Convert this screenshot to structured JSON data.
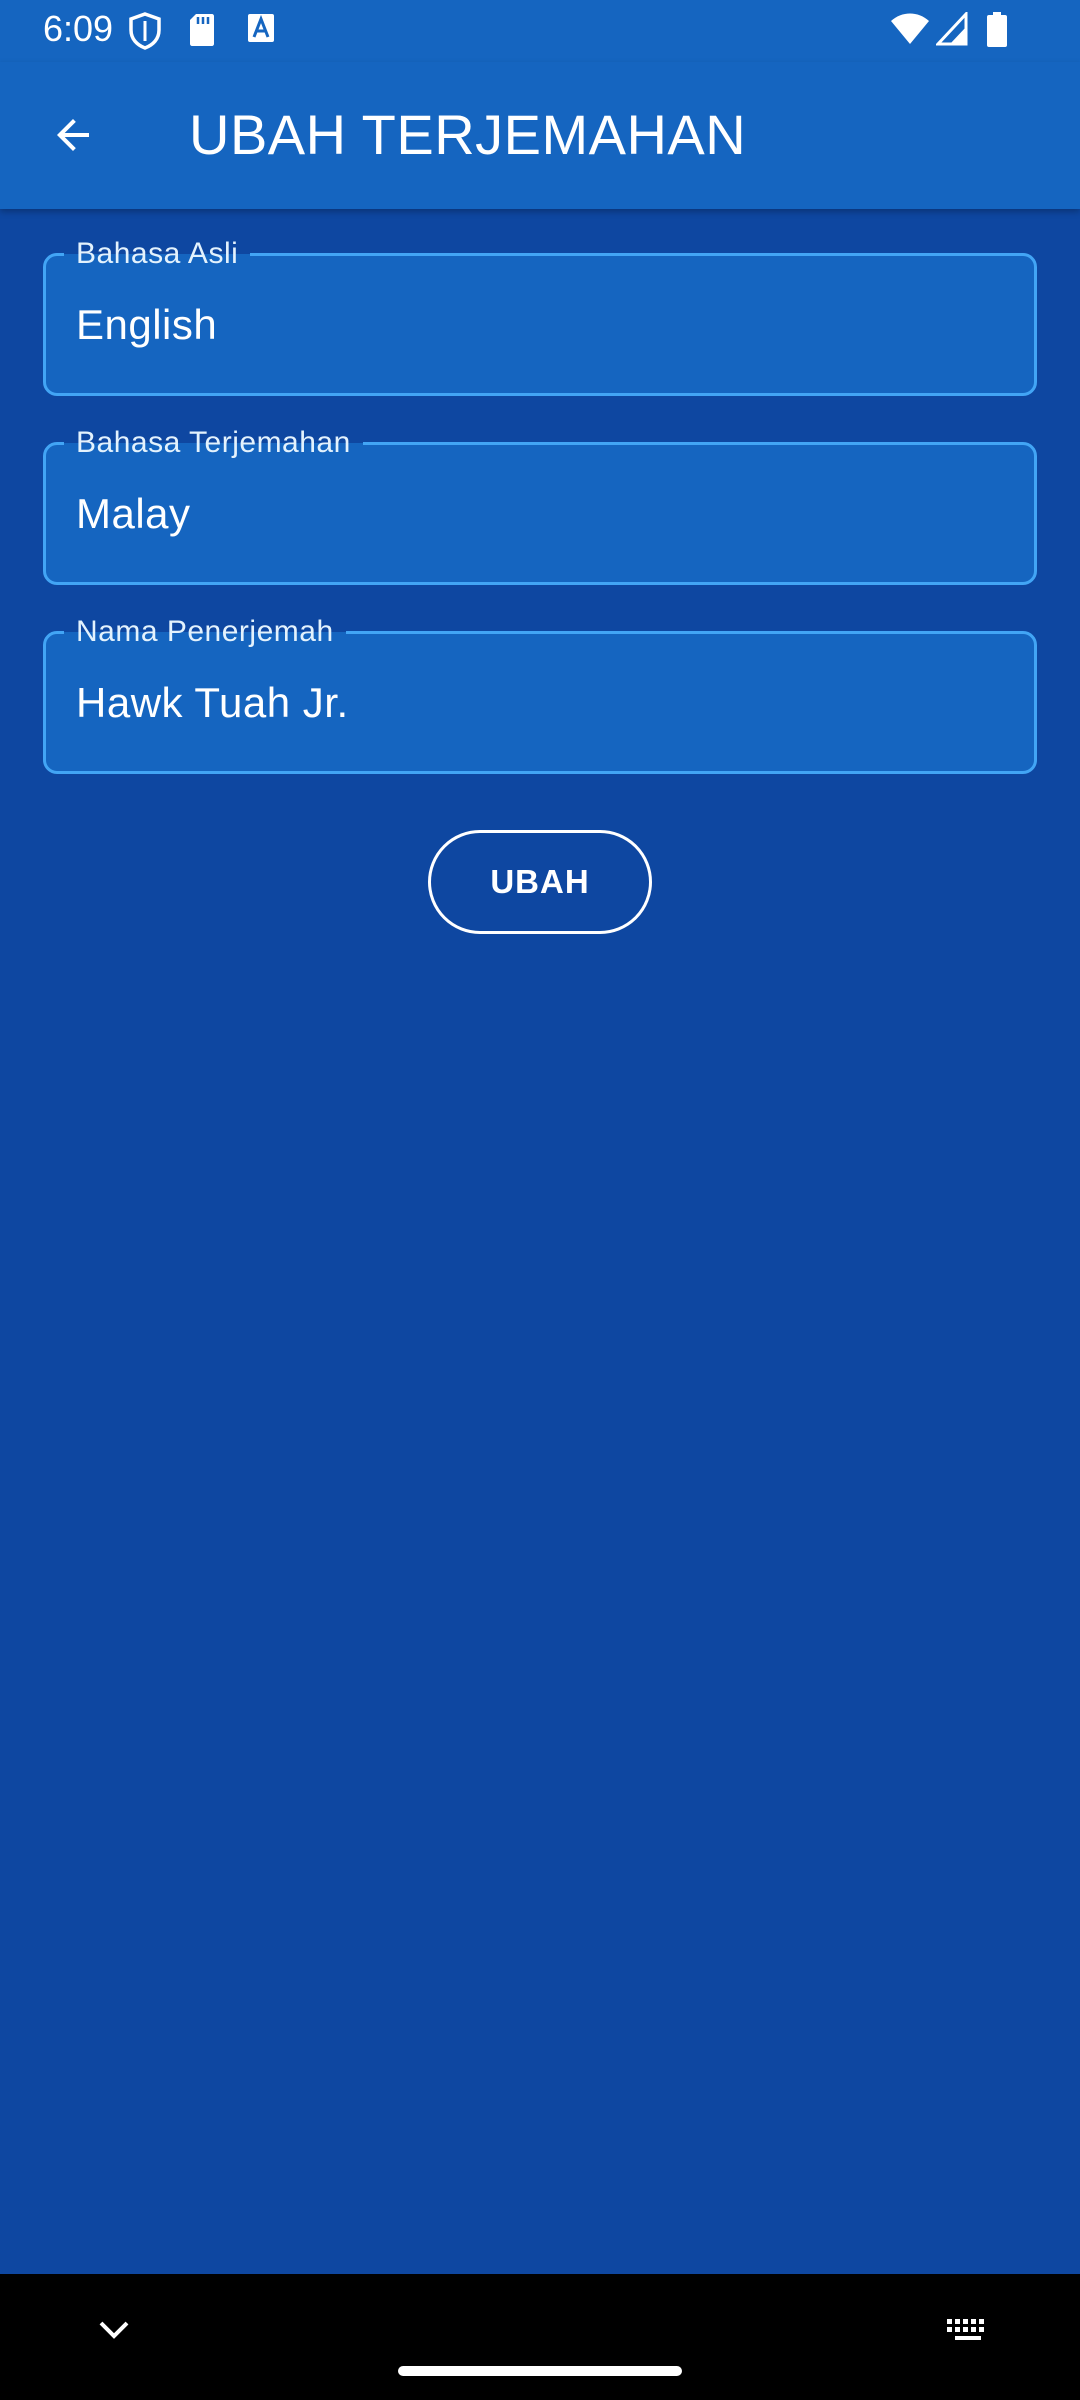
{
  "status_bar": {
    "time": "6:09",
    "left_icons": [
      "shield-icon",
      "sd-card-icon",
      "font-icon"
    ],
    "right_icons": [
      "wifi-icon",
      "signal-icon",
      "battery-icon"
    ]
  },
  "app_bar": {
    "title": "UBAH TERJEMAHAN",
    "back_icon": "arrow-back-icon"
  },
  "form": {
    "fields": [
      {
        "label": "Bahasa Asli",
        "value": "English"
      },
      {
        "label": "Bahasa Terjemahan",
        "value": "Malay"
      },
      {
        "label": "Nama Penerjemah",
        "value": "Hawk Tuah Jr."
      }
    ],
    "submit_label": "UBAH"
  },
  "nav_bar": {
    "left_icon": "chevron-down-icon",
    "right_icon": "keyboard-icon"
  },
  "colors": {
    "background": "#0e47a1",
    "app_bar": "#1565c0",
    "field_fill": "#1565c0",
    "field_border": "#42a5f5",
    "text": "#ffffff"
  }
}
